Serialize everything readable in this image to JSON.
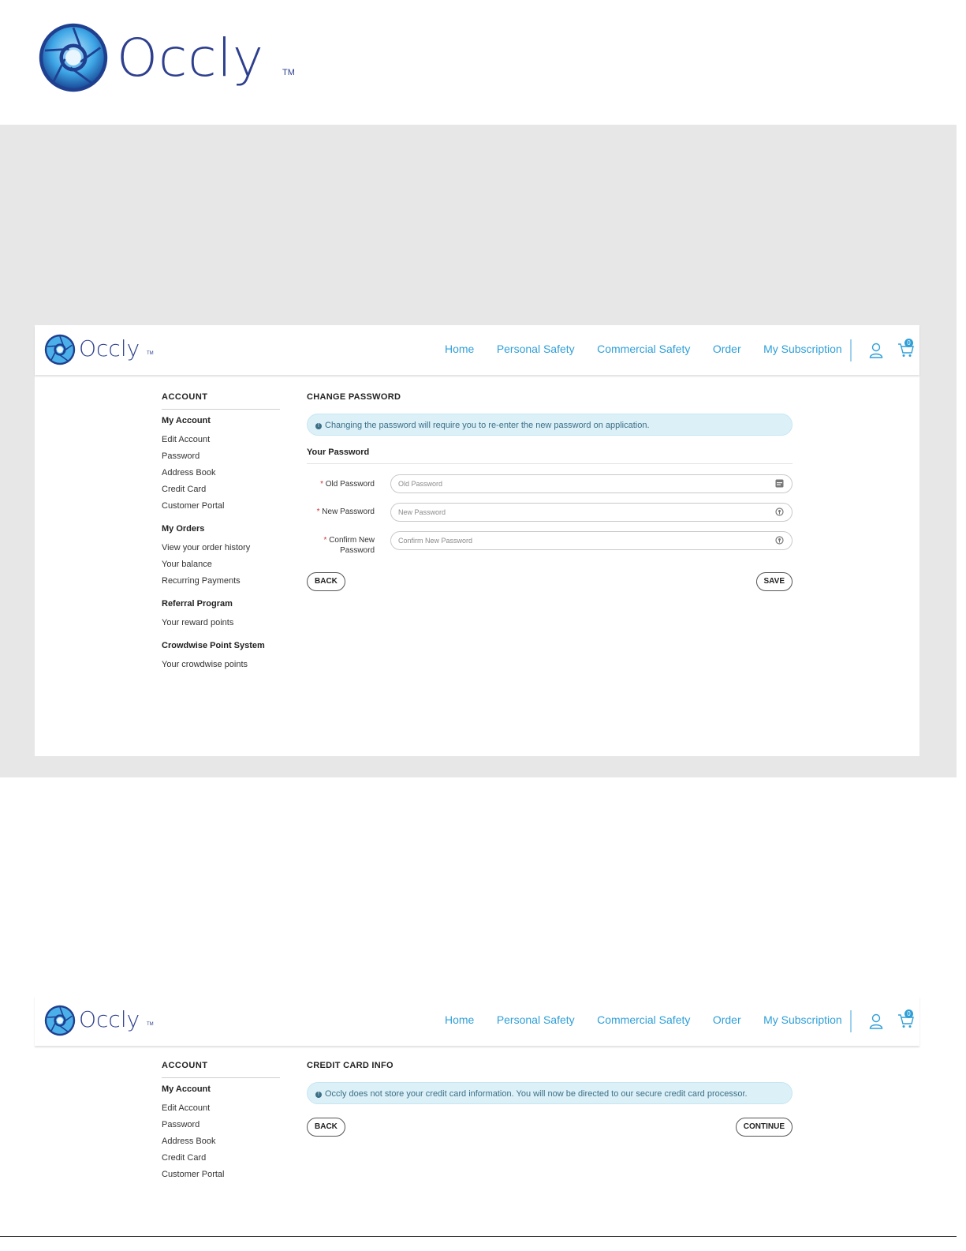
{
  "brand": {
    "name": "Occly",
    "trademark": "TM"
  },
  "colors": {
    "brand_blue": "#2d3f8e",
    "nav_blue": "#2f9fd8",
    "alert_bg": "#dcf0f8",
    "required": "#d32f2f"
  },
  "nav": {
    "items": [
      "Home",
      "Personal Safety",
      "Commercial Safety",
      "Order",
      "My Subscription"
    ],
    "cart_count": "0",
    "icons": [
      "user-icon",
      "cart-icon"
    ]
  },
  "sidebar": {
    "title": "ACCOUNT",
    "groups": [
      {
        "title": "My Account",
        "items": [
          "Edit Account",
          "Password",
          "Address Book",
          "Credit Card",
          "Customer Portal"
        ]
      },
      {
        "title": "My Orders",
        "items": [
          "View your order history",
          "Your balance",
          "Recurring Payments"
        ]
      },
      {
        "title": "Referral Program",
        "items": [
          "Your reward points"
        ]
      },
      {
        "title": "Crowdwise Point System",
        "items": [
          "Your crowdwise points"
        ]
      }
    ]
  },
  "change_password": {
    "title": "CHANGE PASSWORD",
    "alert": "Changing the password will require you to re-enter the new password on application.",
    "section_title": "Your Password",
    "fields": [
      {
        "label": "Old Password",
        "placeholder": "Old Password"
      },
      {
        "label": "New Password",
        "placeholder": "New Password"
      },
      {
        "label_line1": "Confirm New",
        "label_line2": "Password",
        "placeholder": "Confirm New Password"
      }
    ],
    "required_mark": "*",
    "back_label": "BACK",
    "save_label": "SAVE"
  },
  "credit_card": {
    "title": "CREDIT CARD INFO",
    "alert": "Occly does not store your credit card information. You will now be directed to our secure credit card processor.",
    "back_label": "BACK",
    "continue_label": "CONTINUE"
  }
}
